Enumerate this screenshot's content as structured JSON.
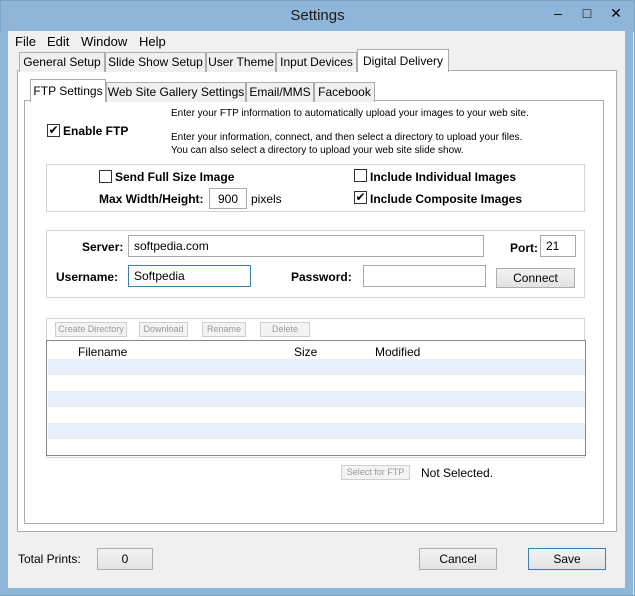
{
  "window": {
    "title": "Settings"
  },
  "menu": [
    "File",
    "Edit",
    "Window",
    "Help"
  ],
  "tabs": [
    {
      "label": "General Setup"
    },
    {
      "label": "Slide Show Setup"
    },
    {
      "label": "User Theme"
    },
    {
      "label": "Input Devices"
    },
    {
      "label": "Digital Delivery",
      "active": true
    }
  ],
  "subtabs": [
    {
      "label": "FTP Settings",
      "active": true
    },
    {
      "label": "Web Site Gallery Settings"
    },
    {
      "label": "Email/MMS"
    },
    {
      "label": "Facebook"
    }
  ],
  "ftp": {
    "enable_label": "Enable FTP",
    "enable_checked": true,
    "info_line1": "Enter your FTP information to automatically upload your images to your web site.",
    "info_line2": "Enter your information, connect, and then select a directory to upload your files.",
    "info_line3": "You can also select a directory to upload your web site slide show."
  },
  "image_options": {
    "send_full_size_label": "Send Full Size Image",
    "send_full_size_checked": false,
    "max_wh_label": "Max Width/Height:",
    "max_wh_value": "900",
    "pixels_label": "pixels",
    "include_individual_label": "Include Individual Images",
    "include_individual_checked": false,
    "include_composite_label": "Include Composite Images",
    "include_composite_checked": true
  },
  "connection": {
    "server_label": "Server:",
    "server_value": "softpedia.com",
    "port_label": "Port:",
    "port_value": "21",
    "username_label": "Username:",
    "username_value": "Softpedia",
    "password_label": "Password:",
    "password_value": "",
    "connect_label": "Connect"
  },
  "file_toolbar": {
    "create_directory": "Create Directory",
    "download": "Download",
    "rename": "Rename",
    "delete": "Delete"
  },
  "file_table": {
    "columns": [
      "Filename",
      "Size",
      "Modified"
    ],
    "rows": []
  },
  "select_for_ftp": {
    "button_label": "Select for FTP",
    "status": "Not Selected."
  },
  "footer": {
    "total_prints_label": "Total Prints:",
    "total_prints_value": "0",
    "cancel_label": "Cancel",
    "save_label": "Save"
  },
  "colors": {
    "titlebar": "#8fb5d9",
    "alt_row": "#e7effa",
    "focus_border": "#3c7fb1"
  }
}
